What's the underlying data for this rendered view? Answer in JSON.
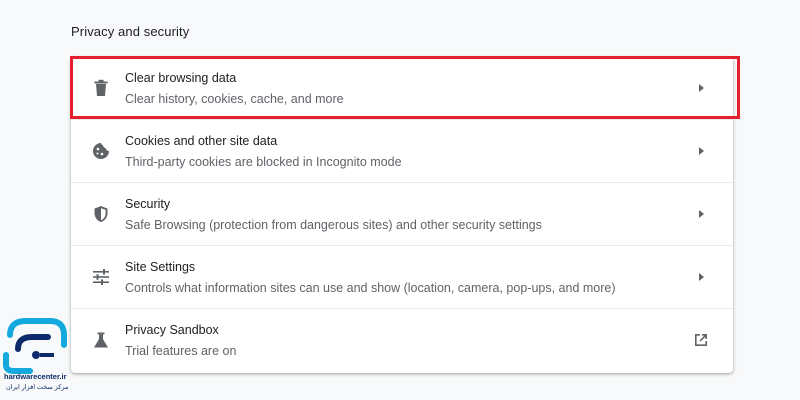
{
  "section": {
    "title": "Privacy and security"
  },
  "rows": [
    {
      "title": "Clear browsing data",
      "subtitle": "Clear history, cookies, cache, and more",
      "icon": "trash-icon",
      "action": "chevron-right-icon"
    },
    {
      "title": "Cookies and other site data",
      "subtitle": "Third-party cookies are blocked in Incognito mode",
      "icon": "cookie-icon",
      "action": "chevron-right-icon"
    },
    {
      "title": "Security",
      "subtitle": "Safe Browsing (protection from dangerous sites) and other security settings",
      "icon": "shield-icon",
      "action": "chevron-right-icon"
    },
    {
      "title": "Site Settings",
      "subtitle": "Controls what information sites can use and show (location, camera, pop-ups, and more)",
      "icon": "tune-icon",
      "action": "chevron-right-icon"
    },
    {
      "title": "Privacy Sandbox",
      "subtitle": "Trial features are on",
      "icon": "flask-icon",
      "action": "open-in-new-icon"
    }
  ],
  "watermark": {
    "site": "hardwarecenter.ir",
    "tagline": "مرکز سخت افزار ایران"
  },
  "colors": {
    "background": "#f8f9fa",
    "card": "#ffffff",
    "icon": "#5f6368",
    "highlight_border": "#e3202d",
    "watermark": "#0d2a6b"
  }
}
